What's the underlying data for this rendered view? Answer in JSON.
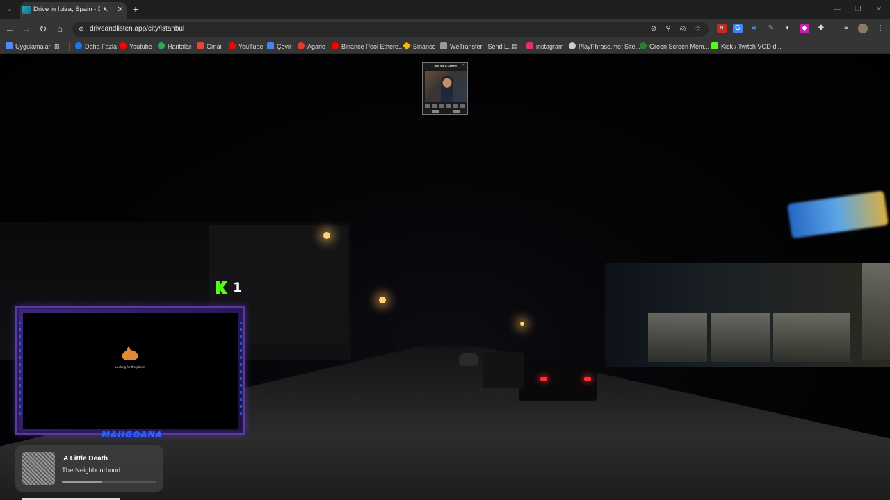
{
  "browser": {
    "tab": {
      "title": "Drive in Ibiza, Spain - Drive and Listen"
    },
    "url": "driveandlisten.app/city/istanbul"
  },
  "icons": {
    "tab_search": "chevron-down-icon",
    "mute": "muted-speaker-icon",
    "close": "close-icon",
    "new_tab": "plus-icon",
    "back": "back-arrow-icon",
    "forward": "forward-arrow-icon",
    "reload": "reload-icon",
    "home": "home-icon",
    "site_info": "tune-icon"
  },
  "bookmarks": [
    {
      "label": "Uygulamalar",
      "color": "#4f8df5"
    },
    {
      "label": "Daha Fazla",
      "color": "#1877f2"
    },
    {
      "label": "Youtube",
      "color": "#ff0000"
    },
    {
      "label": "Haritalar",
      "color": "#34a853"
    },
    {
      "label": "Gmail",
      "color": "#ea4335"
    },
    {
      "label": "YouTube",
      "color": "#ff0000"
    },
    {
      "label": "Çevir",
      "color": "#4285f4"
    },
    {
      "label": "Agario",
      "color": "#e53935"
    },
    {
      "label": "Binance Pool Ethere...",
      "color": "#ff0000"
    },
    {
      "label": "Binance",
      "color": "#f0b90b"
    },
    {
      "label": "WeTransfer - Send L...",
      "color": "#999999"
    },
    {
      "label": "instagram",
      "color": "#e1306c"
    },
    {
      "label": "PlayPhrase.me: Site...",
      "color": "#cccccc"
    },
    {
      "label": "Green Screen Mem...",
      "color": "#2e7d32"
    },
    {
      "label": "Kick / Twitch VOD d...",
      "color": "#53fc18"
    }
  ],
  "stream": {
    "ad_card_title": "Buy Me A Coffee!",
    "kick_viewers": "1",
    "cam_caption": "Looking for the planet",
    "cam_brand": "MAIIGOANA"
  },
  "player": {
    "title": "A Little Death",
    "artist": "The Neighbourhood",
    "progress": 0.42
  }
}
